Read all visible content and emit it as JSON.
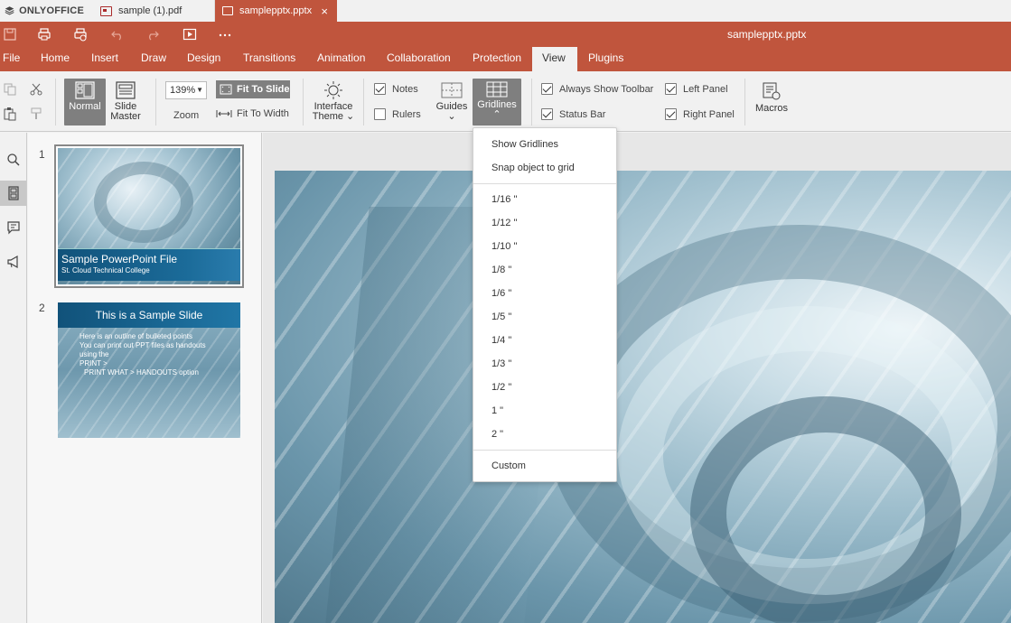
{
  "app": {
    "brand": "ONLYOFFICE",
    "tabs": [
      {
        "label": "sample (1).pdf"
      },
      {
        "label": "samplepptx.pptx",
        "close": "×"
      }
    ],
    "title": "samplepptx.pptx",
    "accent": "#c0553d"
  },
  "menu": {
    "tabs": [
      "File",
      "Home",
      "Insert",
      "Draw",
      "Design",
      "Transitions",
      "Animation",
      "Collaboration",
      "Protection",
      "View",
      "Plugins"
    ],
    "active": "View"
  },
  "ribbon": {
    "normal": "Normal",
    "slide_master_1": "Slide",
    "slide_master_2": "Master",
    "zoom_value": "139%",
    "zoom_label": "Zoom",
    "fit_to_slide": "Fit To Slide",
    "fit_to_width": "Fit To Width",
    "interface_theme_1": "Interface",
    "interface_theme_2": "Theme",
    "notes": "Notes",
    "rulers": "Rulers",
    "guides": "Guides",
    "gridlines": "Gridlines",
    "always_show_toolbar": "Always Show Toolbar",
    "status_bar": "Status Bar",
    "left_panel": "Left Panel",
    "right_panel": "Right Panel",
    "macros": "Macros"
  },
  "thumbnails": [
    {
      "number": "1",
      "title": "Sample PowerPoint File",
      "subtitle": "St. Cloud Technical College"
    },
    {
      "number": "2",
      "title": "This is a Sample Slide",
      "lines": [
        "Here is an outline of bulleted points",
        "You can print out PPT files as handouts",
        "using the",
        "PRINT >",
        "PRINT WHAT > HANDOUTS option"
      ]
    }
  ],
  "gridlines_menu": {
    "show_gridlines": "Show Gridlines",
    "snap_to_grid": "Snap object to grid",
    "sizes": [
      "1/16 \"",
      "1/12 \"",
      "1/10 \"",
      "1/8 \"",
      "1/6 \"",
      "1/5 \"",
      "1/4 \"",
      "1/3 \"",
      "1/2 \"",
      "1 \"",
      "2 \""
    ],
    "custom": "Custom"
  }
}
